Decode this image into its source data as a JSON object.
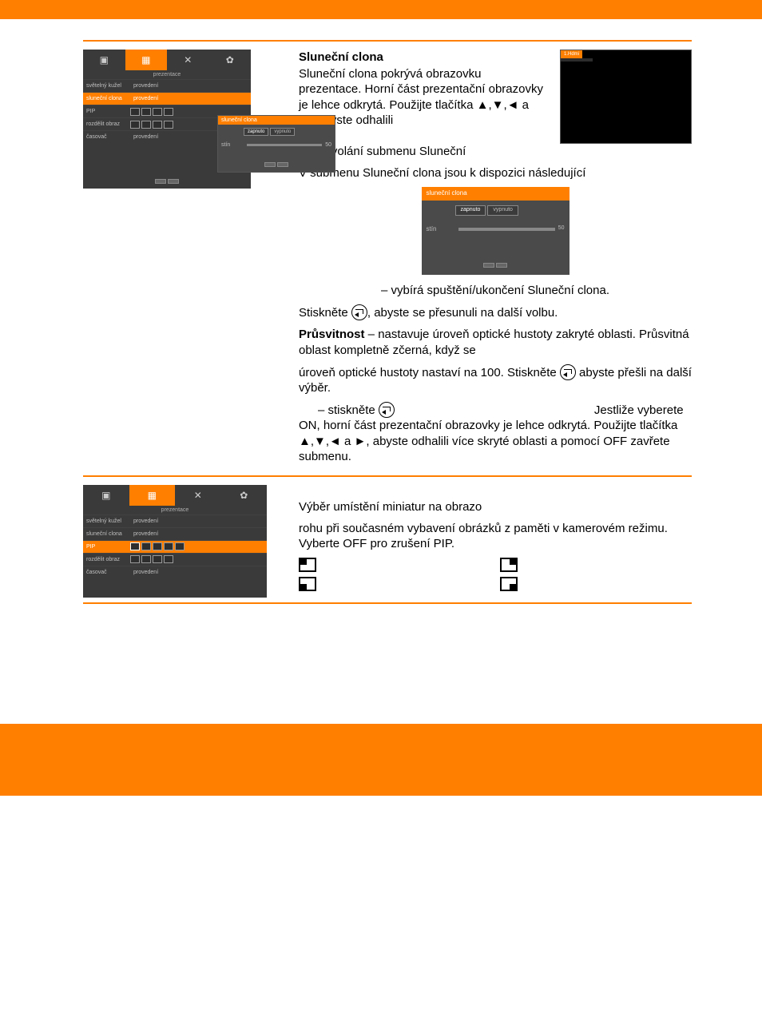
{
  "section1": {
    "heading": "Sluneční clona",
    "p1": "Sluneční clona pokrývá obrazovku prezentace. Horní část prezentační obrazovky je lehce odkrytá. Použijte tlačítka ▲,▼,◄ a ►, abyste odhalili",
    "p2": "pro vyvolání submenu Sluneční",
    "p3": "V submenu Sluneční clona jsou k dispozici následující",
    "line_select": "– vybírá spuštění/ukončení Sluneční clona.",
    "press1_a": "Stiskněte ",
    "press1_b": ", abyste se přesunuli na další volbu.",
    "prusvitnost_label": "Průsvitnost",
    "prusvitnost_text": " – nastavuje úroveň optické hustoty zakryté oblasti. Průsvitná oblast kompletně zčerná, když se",
    "press2_a": "úroveň optické hustoty nastaví na 100. Stiskněte ",
    "press2_b": "abyste přešli na další výběr.",
    "press3_a": "– stiskněte ",
    "press3_b": "Jestliže vyberete ON, horní část prezentační obrazovky je lehce odkrytá. Použijte tlačítka ▲,▼,◄ a ►, abyste odhalili více skryté oblasti a pomocí OFF zavřete submenu."
  },
  "section2": {
    "p1": "Výběr umístění miniatur na obrazo",
    "p2": "rohu při současném vybavení obrázků z paměti v kamerovém režimu. Vyberte OFF pro zrušení PIP."
  },
  "menu1": {
    "title": "prezentace",
    "items": [
      {
        "label": "světelný kužel",
        "val": "provedení"
      },
      {
        "label": "sluneční clona",
        "val": "provedení",
        "sel": true
      },
      {
        "label": "PIP",
        "val": ""
      },
      {
        "label": "rozdělit obraz",
        "val": ""
      },
      {
        "label": "časovač",
        "val": "provedení"
      }
    ],
    "sub_title": "sluneční clona",
    "sub_on": "zapnuto",
    "sub_off": "vypnuto",
    "sub_stin": "stín",
    "sub_val": "50"
  },
  "menu2": {
    "title": "prezentace",
    "items": [
      {
        "label": "světelný kužel",
        "val": "provedení"
      },
      {
        "label": "sluneční clona",
        "val": "provedení"
      },
      {
        "label": "PIP",
        "val": "",
        "sel": true
      },
      {
        "label": "rozdělit obraz",
        "val": ""
      },
      {
        "label": "časovač",
        "val": "provedení"
      }
    ]
  },
  "center": {
    "title": "sluneční clona",
    "on": "zapnuto",
    "off": "vypnuto",
    "stin": "stín",
    "val": "50"
  },
  "preview_tab": "1.Hdmi"
}
